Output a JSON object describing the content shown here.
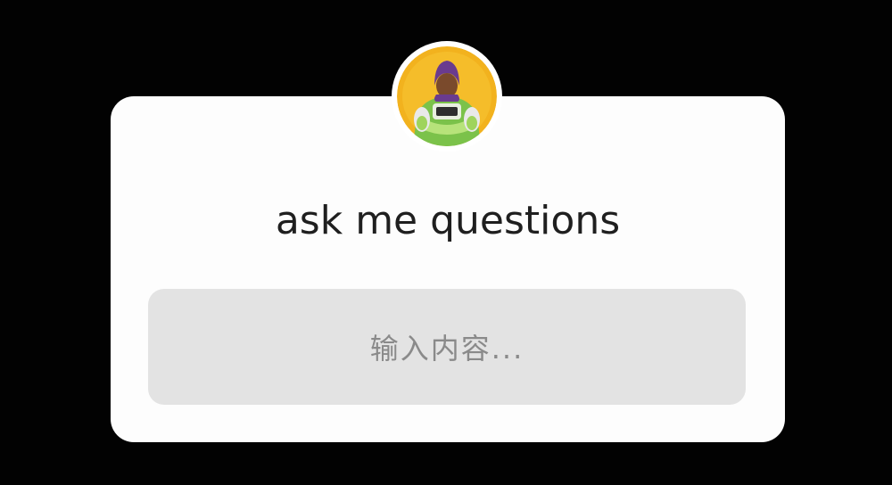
{
  "sticker": {
    "title": "ask me questions",
    "input_placeholder": "输入内容..."
  },
  "colors": {
    "background": "#000000",
    "card": "#fdfdfd",
    "input_bg": "#e3e3e3",
    "title_text": "#1f1f1f",
    "placeholder_text": "#8a8a8a",
    "avatar_bg": "#f2b21e"
  },
  "icons": {
    "avatar": "profile-avatar-photo"
  }
}
